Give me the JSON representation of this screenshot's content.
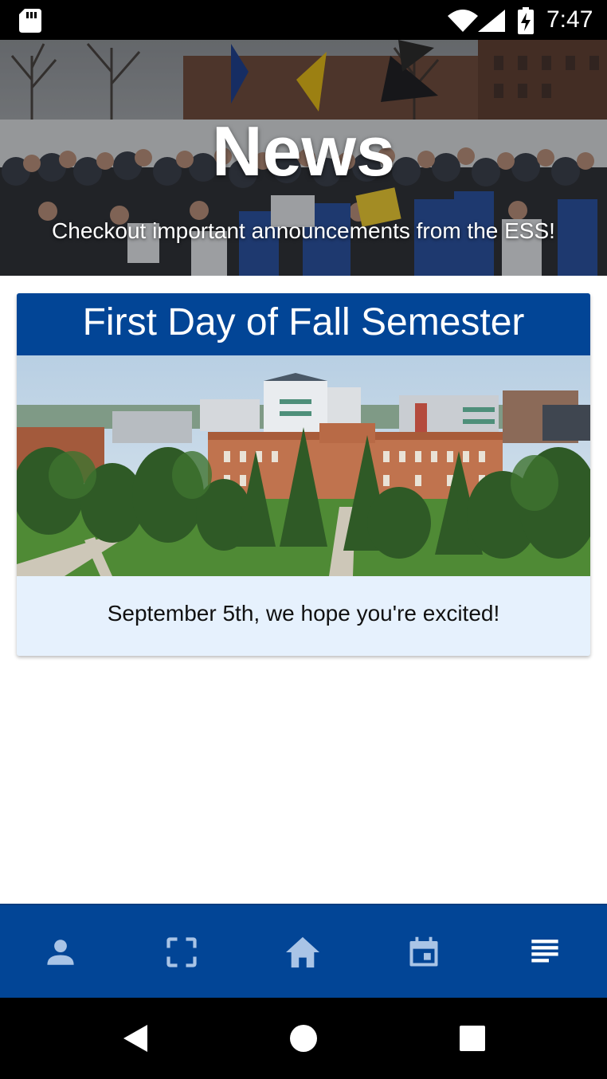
{
  "status_bar": {
    "time": "7:47",
    "icons": [
      "sd-card-icon",
      "wifi-icon",
      "signal-icon",
      "battery-charging-icon"
    ]
  },
  "hero": {
    "title": "News",
    "subtitle": "Checkout important announcements from the ESS!"
  },
  "news": [
    {
      "title": "First Day of Fall Semester",
      "body": "September 5th, we hope you're excited!"
    }
  ],
  "bottom_nav": {
    "items": [
      {
        "icon": "person-icon",
        "active": false
      },
      {
        "icon": "scan-icon",
        "active": false
      },
      {
        "icon": "home-icon",
        "active": false
      },
      {
        "icon": "calendar-icon",
        "active": false
      },
      {
        "icon": "news-list-icon",
        "active": true
      }
    ]
  },
  "system_nav": {
    "buttons": [
      "back-icon",
      "home-circle-icon",
      "recents-icon"
    ]
  },
  "colors": {
    "primary": "#024596",
    "card_body_bg": "#e6f1fd",
    "inactive_icon": "#a9c4e6",
    "active_icon": "#ffffff"
  }
}
